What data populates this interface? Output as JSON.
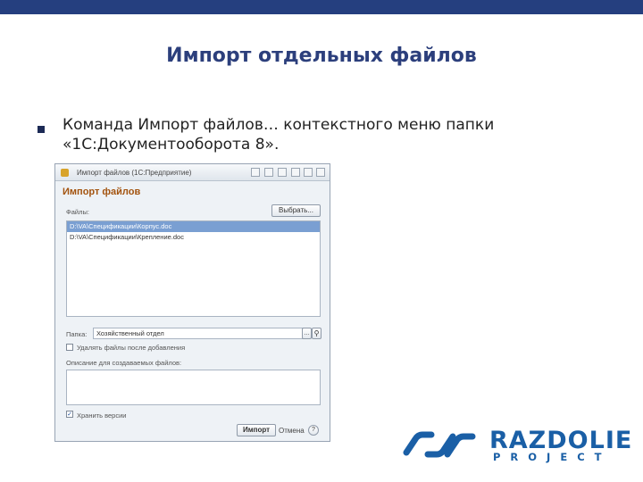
{
  "slide": {
    "title": "Импорт отдельных файлов",
    "bullet_text": "Команда Импорт файлов… контекстного меню папки «1С:Документооборота 8»."
  },
  "window": {
    "title": "Импорт файлов (1С:Предприятие)",
    "form_title": "Импорт файлов",
    "files_label": "Файлы:",
    "select_button": "Выбрать...",
    "files": [
      {
        "path": "D:\\VA\\Спецификации\\Корпус.doc",
        "selected": true
      },
      {
        "path": "D:\\VA\\Спецификации\\Крепление.doc",
        "selected": false
      }
    ],
    "folder_label": "Папка:",
    "folder_value": "Хозяйственный отдел",
    "delete_after_label": "Удалять файлы после добавления",
    "delete_after_checked": false,
    "description_label": "Описание для создаваемых файлов:",
    "description_value": "",
    "keep_versions_label": "Хранить версии",
    "keep_versions_checked": true,
    "import_button": "Импорт",
    "cancel_button": "Отмена",
    "help_button": "?"
  },
  "logo": {
    "name": "RAZDOLIE",
    "sub": "PROJECT"
  },
  "colors": {
    "top_bar": "#253f7f",
    "title": "#2c3f7c",
    "form_title": "#a3530e",
    "selection": "#7a9fd2",
    "logo": "#1a5fa6"
  }
}
